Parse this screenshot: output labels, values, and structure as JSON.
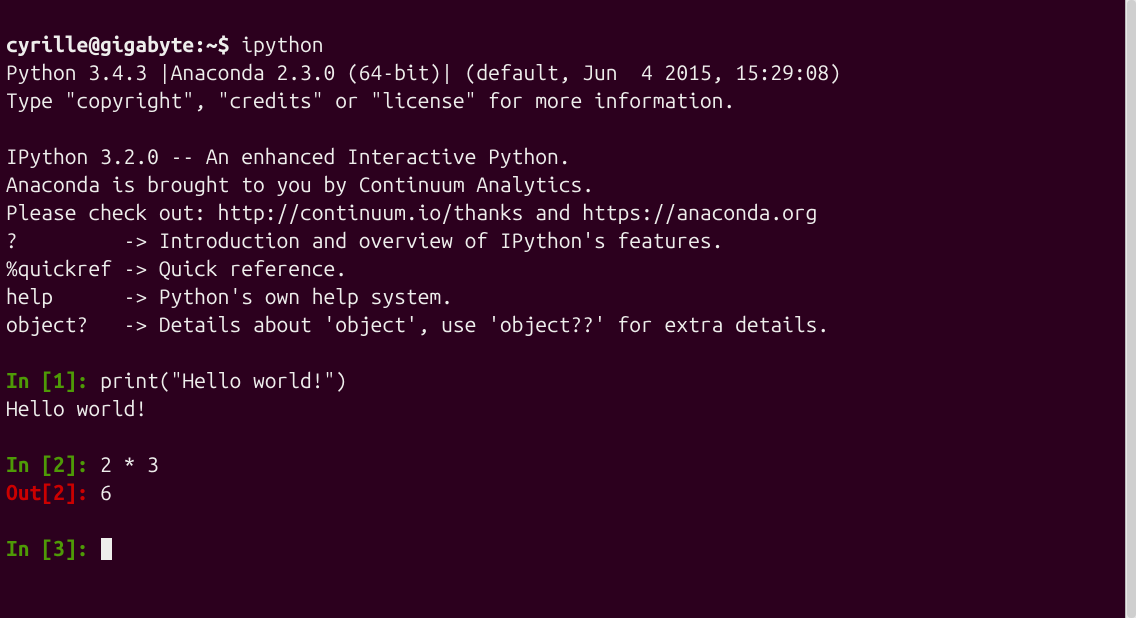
{
  "shell": {
    "prompt": "cyrille@gigabyte:~$",
    "command": "ipython"
  },
  "banner": {
    "line1": "Python 3.4.3 |Anaconda 2.3.0 (64-bit)| (default, Jun  4 2015, 15:29:08)",
    "line2": "Type \"copyright\", \"credits\" or \"license\" for more information.",
    "line3": "",
    "line4": "IPython 3.2.0 -- An enhanced Interactive Python.",
    "line5": "Anaconda is brought to you by Continuum Analytics.",
    "line6": "Please check out: http://continuum.io/thanks and https://anaconda.org",
    "line7": "?         -> Introduction and overview of IPython's features.",
    "line8": "%quickref -> Quick reference.",
    "line9": "help      -> Python's own help system.",
    "line10": "object?   -> Details about 'object', use 'object??' for extra details."
  },
  "cells": {
    "in1": {
      "prefix": "In [",
      "num": "1",
      "suffix": "]: ",
      "code": "print(\"Hello world!\")"
    },
    "out1_text": "Hello world!",
    "in2": {
      "prefix": "In [",
      "num": "2",
      "suffix": "]: ",
      "code": "2 * 3"
    },
    "out2": {
      "prefix": "Out[",
      "num": "2",
      "suffix": "]: ",
      "value": "6"
    },
    "in3": {
      "prefix": "In [",
      "num": "3",
      "suffix": "]: "
    }
  }
}
